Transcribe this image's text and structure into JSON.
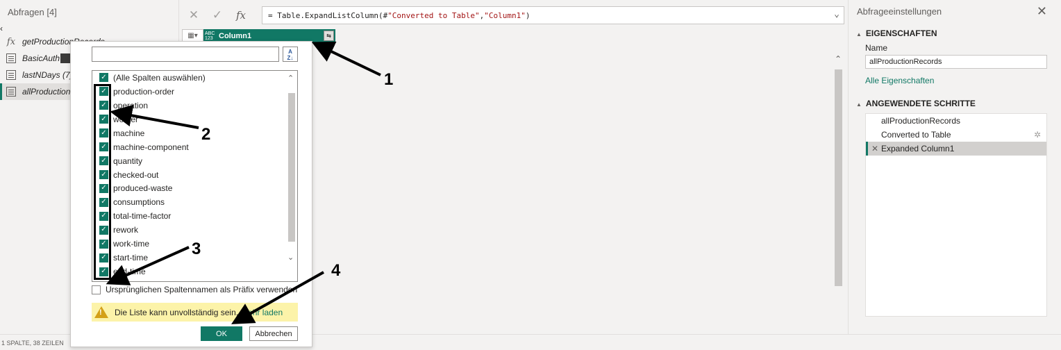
{
  "left_pane": {
    "header": "Abfragen [4]",
    "queries": [
      {
        "label": "getProductionRecords",
        "icon": "fx-icon"
      },
      {
        "label": "BasicAuth",
        "icon": "table-icon"
      },
      {
        "label": "lastNDays (7)",
        "icon": "table-icon"
      },
      {
        "label": "allProductionRecords",
        "icon": "table-icon",
        "selected": true
      }
    ]
  },
  "formula_bar": {
    "prefix": "= Table.ExpandListColumn(#",
    "arg1": "\"Converted to Table\"",
    "sep": ", ",
    "arg2": "\"Column1\"",
    "suffix": ")"
  },
  "grid": {
    "column_type": "ABC 123",
    "column_name": "Column1"
  },
  "dropdown": {
    "select_all": "(Alle Spalten auswählen)",
    "columns": [
      "production-order",
      "operation",
      "worker",
      "machine",
      "machine-component",
      "quantity",
      "checked-out",
      "produced-waste",
      "consumptions",
      "total-time-factor",
      "rework",
      "work-time",
      "start-time",
      "end-time"
    ],
    "prefix_label": "Ursprünglichen Spaltennamen als Präfix verwenden",
    "warning_text": "Die Liste kann unvollständig sein.",
    "more_link": "Mehr laden",
    "ok_label": "OK",
    "cancel_label": "Abbrechen"
  },
  "right_pane": {
    "title": "Abfrageeinstellungen",
    "properties_heading": "EIGENSCHAFTEN",
    "name_label": "Name",
    "name_value": "allProductionRecords",
    "all_properties_link": "Alle Eigenschaften",
    "steps_heading": "ANGEWENDETE SCHRITTE",
    "steps": [
      "allProductionRecords",
      "Converted to Table",
      "Expanded Column1"
    ]
  },
  "status_bar": {
    "text": "1 SPALTE, 38 ZEILEN"
  },
  "annotations": [
    "1",
    "2",
    "3",
    "4"
  ],
  "colors": {
    "accent": "#117865",
    "warning_bg": "#fcf3a9"
  }
}
